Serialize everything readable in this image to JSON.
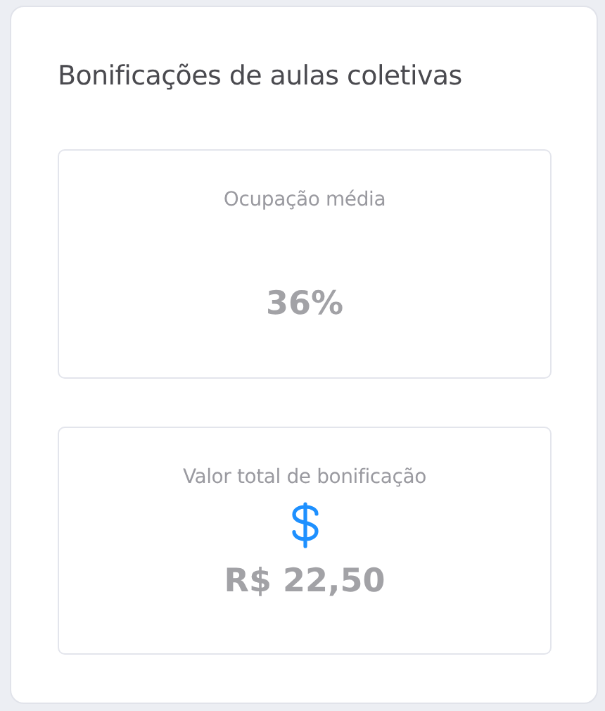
{
  "panel": {
    "title": "Bonificações de aulas coletivas"
  },
  "stats": [
    {
      "kind": "plain",
      "label": "Ocupação média",
      "value": "36%"
    },
    {
      "kind": "money",
      "label": "Valor total de bonificação",
      "value": "R$ 22,50"
    }
  ]
}
